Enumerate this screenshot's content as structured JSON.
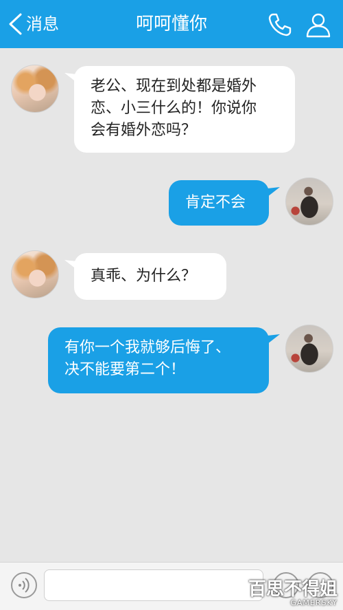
{
  "header": {
    "back_label": "消息",
    "title": "呵呵懂你",
    "phone_icon": "phone-icon",
    "person_icon": "person-icon",
    "background": "#1aa0e6"
  },
  "messages": [
    {
      "side": "left",
      "text_lines": [
        "老公、现在到处都是婚外",
        "恋、小三什么的！你说你",
        "会有婚外恋吗？"
      ]
    },
    {
      "side": "right",
      "text_lines": [
        "肯定不会"
      ]
    },
    {
      "side": "left",
      "text_lines": [
        "真乖、为什么？"
      ]
    },
    {
      "side": "right",
      "text_lines": [
        "有你一个我就够后悔了、",
        "决不能要第二个！"
      ]
    }
  ],
  "input_bar": {
    "voice_icon": "voice-icon",
    "input_value": "",
    "emoji_icon": "emoji-icon",
    "plus_icon": "plus-icon"
  },
  "watermark": {
    "main": "百思不得姐",
    "sub": "GAMERSKY"
  },
  "colors": {
    "accent": "#1aa0e6",
    "background": "#e6e6e6",
    "bubble_left": "#ffffff"
  }
}
